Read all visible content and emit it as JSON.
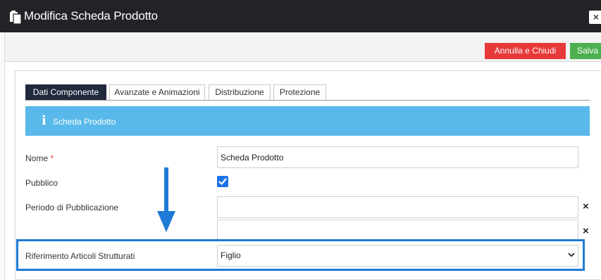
{
  "window": {
    "title": "Modifica Scheda Prodotto",
    "close_label": "×"
  },
  "toolbar": {
    "cancel_label": "Annulla e Chiudi",
    "save_label": "Salva"
  },
  "tabs": [
    {
      "label": "Dati Componente",
      "active": true
    },
    {
      "label": "Avanzate e Animazioni",
      "active": false
    },
    {
      "label": "Distribuzione",
      "active": false
    },
    {
      "label": "Protezione",
      "active": false
    }
  ],
  "banner": {
    "icon": "info-icon",
    "title": "Scheda Prodotto"
  },
  "form": {
    "nome": {
      "label": "Nome",
      "required_mark": "*",
      "value": "Scheda Prodotto"
    },
    "pubblico": {
      "label": "Pubblico",
      "checked": true
    },
    "periodo": {
      "label": "Periodo di Pubblicazione",
      "start_value": "",
      "end_value": "",
      "clear_label": "×"
    },
    "riferimento": {
      "label": "Riferimento Articoli Strutturati",
      "selected": "Figlio"
    }
  },
  "colors": {
    "titlebar": "#222327",
    "cancel": "#e8393a",
    "save": "#4cb050",
    "active_tab": "#1f2a3c",
    "banner": "#58b9ea",
    "checkbox": "#1b73e8",
    "highlight": "#1e7ad6"
  }
}
